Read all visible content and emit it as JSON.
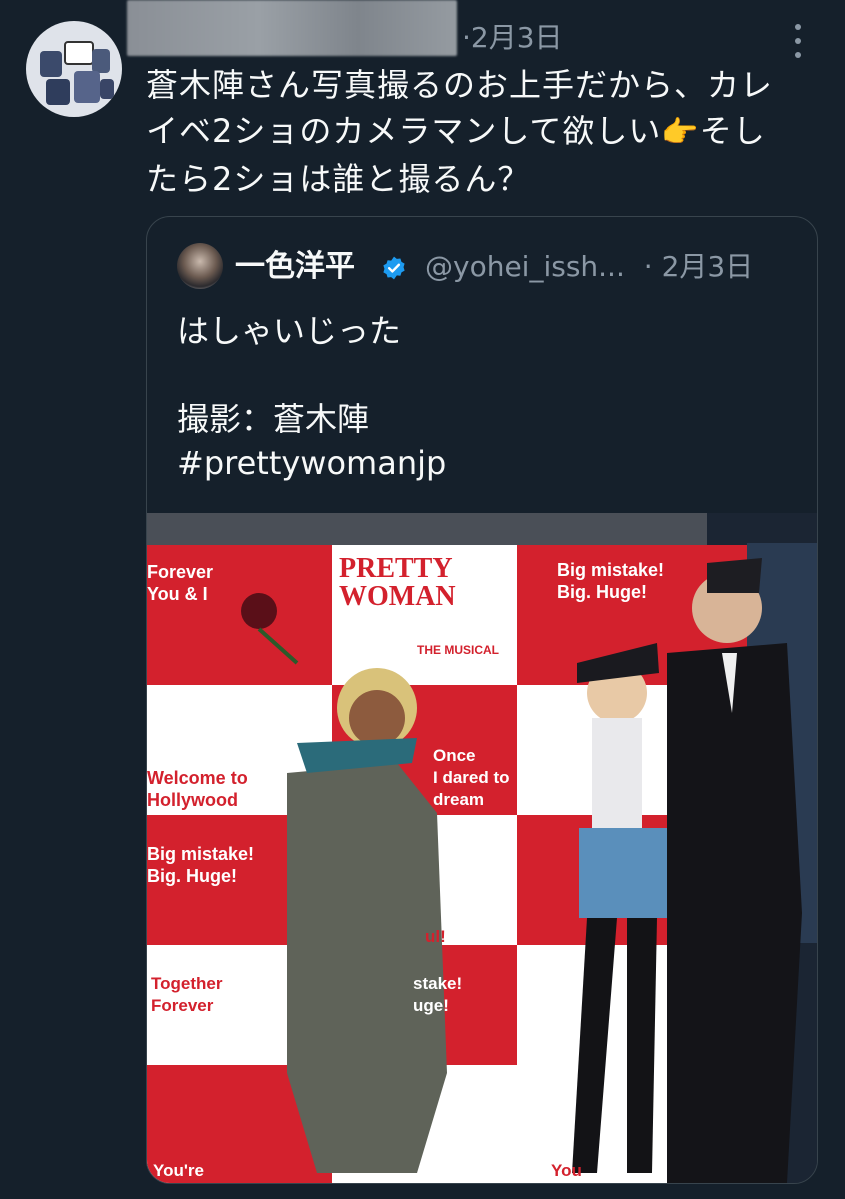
{
  "tweet": {
    "date": "2月3日",
    "text_line1": "蒼木陣さん写真撮るのお上手だから、カレ",
    "text_line2_a": "イベ2ショのカメラマンして欲しい",
    "text_line2_emoji": "👉",
    "text_line2_b": "そし",
    "text_line3": "たら2ショは誰と撮るん？"
  },
  "quote": {
    "display_name": "一色洋平",
    "handle": "@yohei_issh...",
    "date_sep": "·",
    "date": "2月3日",
    "line1": "はしゃいじった",
    "line2": "撮影：蒼木陣",
    "line3": "#prettywomanjp"
  },
  "photo": {
    "panel_texts": [
      "Forever\nYou & I",
      "PRETTY\nWOMAN",
      "THE MUSICAL",
      "Big mistake!\nBig. Huge!",
      "Welcome to\nHollywood",
      "Once\nI dared to\ndream",
      "Big mistake!\nBig. Huge!",
      "Together\nForever",
      "ul!",
      "stake!\nuge!",
      "You're",
      "Once\nI dared to",
      "You"
    ]
  },
  "colors": {
    "background": "#15202b",
    "text": "#f7f9f9",
    "muted": "#8b98a5",
    "border": "#38444d",
    "verified": "#1d9bf0",
    "poster_red": "#d3212d"
  }
}
